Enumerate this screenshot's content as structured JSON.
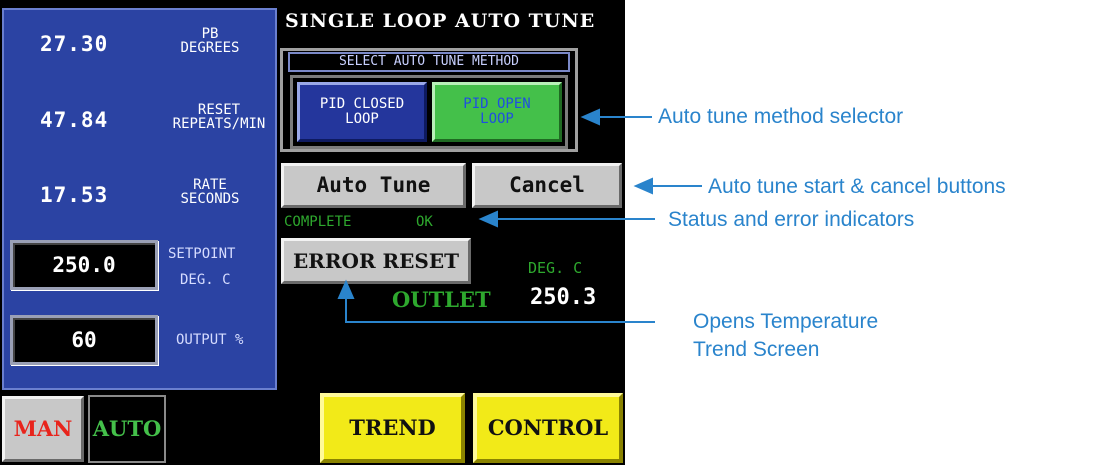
{
  "screen": {
    "title": "SINGLE LOOP AUTO TUNE",
    "readings": {
      "pb": {
        "value": "27.30",
        "label_line1": "PB",
        "label_line2": "DEGREES"
      },
      "reset": {
        "value": "47.84",
        "label_line1": "RESET",
        "label_line2": "REPEATS/MIN"
      },
      "rate": {
        "value": "17.53",
        "label_line1": "RATE",
        "label_line2": "SECONDS"
      }
    },
    "setpoint": {
      "value": "250.0",
      "label": "SETPOINT",
      "unit": "DEG. C"
    },
    "output": {
      "value": "60",
      "label": "OUTPUT %"
    },
    "method": {
      "header": "SELECT AUTO TUNE METHOD",
      "closed_loop": {
        "line1": "PID CLOSED",
        "line2": "LOOP"
      },
      "open_loop": {
        "line1": "PID OPEN",
        "line2": "LOOP"
      }
    },
    "buttons": {
      "auto_tune": "Auto Tune",
      "cancel": "Cancel",
      "error_reset": "ERROR RESET",
      "man": "MAN",
      "auto": "AUTO",
      "trend": "TREND",
      "control": "CONTROL"
    },
    "status": {
      "complete": "COMPLETE",
      "ok": "OK"
    },
    "outlet": {
      "label": "OUTLET",
      "unit": "DEG. C",
      "value": "250.3"
    }
  },
  "annotations": {
    "method_selector": "Auto tune method selector",
    "start_cancel": "Auto tune start & cancel buttons",
    "status": "Status and error indicators",
    "trend_line1": "Opens Temperature",
    "trend_line2": "Trend Screen"
  },
  "colors": {
    "panel_blue": "#2b43a3",
    "active_green": "#44c04a",
    "trend_yellow": "#f2ea18",
    "annotation_blue": "#2a84cc",
    "status_green": "#2ea82e"
  }
}
